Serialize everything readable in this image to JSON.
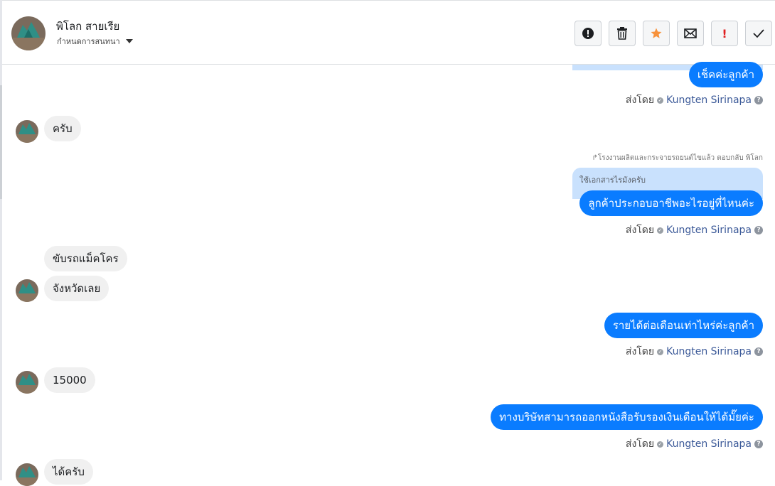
{
  "header": {
    "name": "พิโลก สายเรีย",
    "assign_label": "กำหนดการสนทนา",
    "toolbar": {
      "spam_icon": "alert-circle-icon",
      "delete_icon": "trash-icon",
      "star_icon": "star-icon",
      "email_icon": "envelope-icon",
      "flag_icon": "exclamation-icon",
      "done_icon": "check-icon",
      "flag_label": "!"
    },
    "star_color": "#f7923b",
    "flag_color": "#e02020"
  },
  "messages": [
    {
      "from": "page",
      "text": "เช็คค่ะลูกค้า"
    },
    {
      "from": "user",
      "text": "ครับ"
    },
    {
      "from": "page",
      "reply_note": "โรงงานผลิตและกระจายรถยนต์ไขแล้ว ตอบกลับ พิโลก",
      "quoted": "ใช้เอกสารไรมังครับ",
      "text": "ลูกค้าประกอบอาชีพอะไรอยู่ที่ไหนค่ะ"
    },
    {
      "from": "user",
      "text": "ขับรถแม็คโคร"
    },
    {
      "from": "user",
      "text": "จังหวัดเลย"
    },
    {
      "from": "page",
      "text": "รายได้ต่อเดือนเท่าไหร่ค่ะลูกค้า"
    },
    {
      "from": "user",
      "text": "15000"
    },
    {
      "from": "page",
      "text": "ทางบริษัทสามารถออกหนังสือรับรองเงินเดือนให้ได้มั๊ยค่ะ"
    },
    {
      "from": "user",
      "text": "ได้ครับ"
    }
  ],
  "sent_by": {
    "prefix": "ส่งโดย",
    "agent": "Kungten Sirinapa",
    "help": "?"
  },
  "accent_color": "#0a7cff"
}
